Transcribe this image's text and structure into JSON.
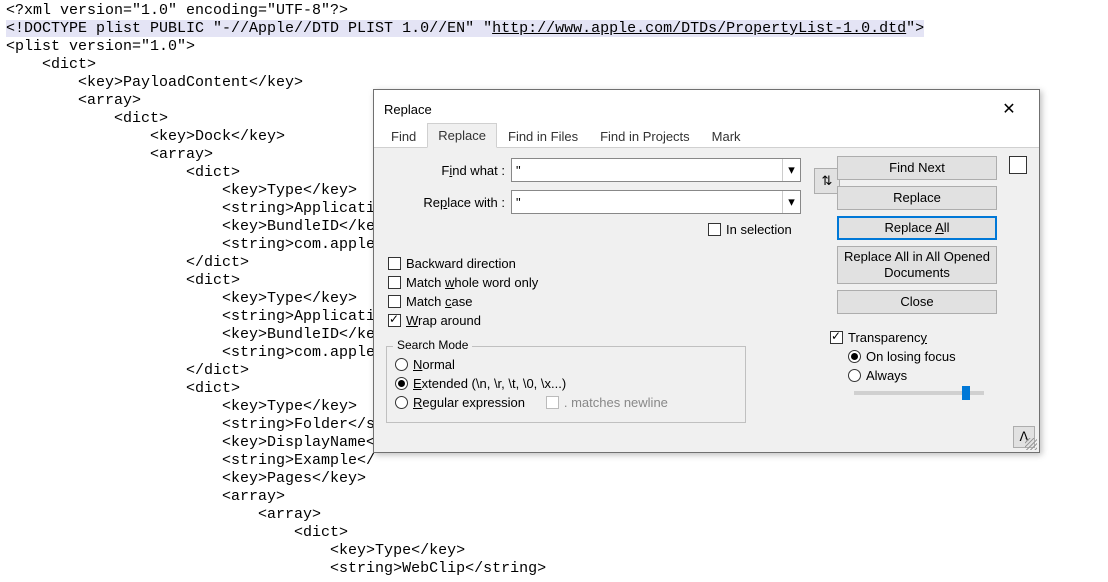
{
  "editor": {
    "lines": [
      "<?xml version=\"1.0\" encoding=\"UTF-8\"?>",
      "<!DOCTYPE plist PUBLIC \"-//Apple//DTD PLIST 1.0//EN\" ",
      "\"http://www.apple.com/DTDs/PropertyList-1.0.dtd\">",
      "<plist version=\"1.0\">",
      "    <dict>",
      "        <key>PayloadContent</key>",
      "        <array>",
      "            <dict>",
      "                <key>Dock</key>",
      "                <array>",
      "                    <dict>",
      "                        <key>Type</key>",
      "                        <string>Applicati",
      "                        <key>BundleID</ke",
      "                        <string>com.apple",
      "                    </dict>",
      "                    <dict>",
      "                        <key>Type</key>",
      "                        <string>Applicati",
      "                        <key>BundleID</ke",
      "                        <string>com.apple",
      "                    </dict>",
      "                    <dict>",
      "                        <key>Type</key>",
      "                        <string>Folder</s",
      "                        <key>DisplayName<",
      "                        <string>Example</",
      "                        <key>Pages</key>",
      "                        <array>",
      "                            <array>",
      "                                <dict>",
      "                                    <key>Type</key>",
      "                                    <string>WebClip</string>"
    ]
  },
  "dialog": {
    "title": "Replace",
    "tabs": [
      "Find",
      "Replace",
      "Find in Files",
      "Find in Projects",
      "Mark"
    ],
    "active_tab": 1,
    "find_label": "Find what :",
    "replace_label": "Replace with :",
    "find_value": "\"",
    "replace_value": "\"",
    "in_selection": "In selection",
    "buttons": {
      "find_next": "Find Next",
      "replace": "Replace",
      "replace_all": "Replace All",
      "replace_all_opened": "Replace All in All Opened Documents",
      "close": "Close"
    },
    "options": {
      "backward": "Backward direction",
      "whole_word": "Match whole word only",
      "match_case": "Match case",
      "wrap": "Wrap around"
    },
    "search_mode": {
      "legend": "Search Mode",
      "normal": "Normal",
      "extended": "Extended (\\n, \\r, \\t, \\0, \\x...)",
      "regex": "Regular expression",
      "matches_newline": ". matches newline"
    },
    "transparency": {
      "label": "Transparency",
      "on_losing": "On losing focus",
      "always": "Always"
    },
    "expand": "ᐱ"
  },
  "accesskeys": {
    "find_i": "i",
    "replace_p": "p",
    "whole_w": "w",
    "case_c": "c",
    "wrap_w": "W",
    "normal_n": "N",
    "extended_e": "E",
    "regex_r": "R",
    "transp_y": "y",
    "replaceall_a": "A"
  }
}
